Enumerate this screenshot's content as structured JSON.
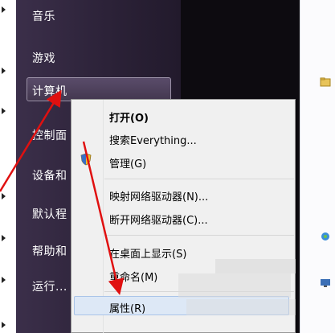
{
  "start_menu": {
    "items": [
      {
        "label": "音乐"
      },
      {
        "label": "游戏"
      },
      {
        "label": "计算机"
      },
      {
        "label": "控制面"
      },
      {
        "label": "设备和"
      },
      {
        "label": "默认程"
      },
      {
        "label": "帮助和"
      },
      {
        "label": "运行..."
      }
    ]
  },
  "context_menu": {
    "items": [
      {
        "label": "打开(O)",
        "bold": true
      },
      {
        "label": "搜索Everything..."
      },
      {
        "label": "管理(G)",
        "icon": "shield-icon"
      },
      {
        "label": "映射网络驱动器(N)..."
      },
      {
        "label": "断开网络驱动器(C)..."
      },
      {
        "label": "在桌面上显示(S)"
      },
      {
        "label": "重命名(M)"
      },
      {
        "label": "属性(R)"
      }
    ]
  },
  "colors": {
    "annotation_arrow": "#e01010",
    "start_menu_bg": "#2c2238",
    "highlight": "#dde8f6"
  }
}
